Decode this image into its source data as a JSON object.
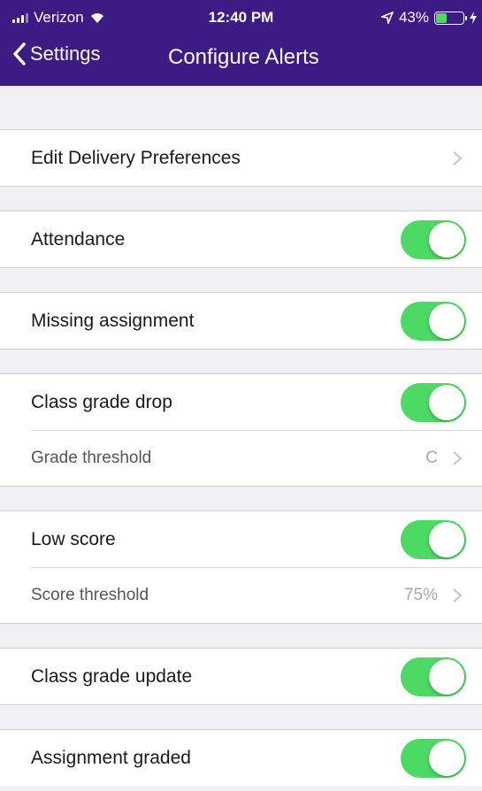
{
  "status_bar": {
    "carrier": "Verizon",
    "time": "12:40 PM",
    "battery": "43%",
    "battery_level": 0.43
  },
  "nav": {
    "back_label": "Settings",
    "title": "Configure Alerts"
  },
  "rows": {
    "delivery": "Edit Delivery Preferences",
    "attendance": "Attendance",
    "missing": "Missing assignment",
    "class_drop": "Class grade drop",
    "grade_threshold": "Grade threshold",
    "grade_threshold_value": "C",
    "low_score": "Low score",
    "score_threshold": "Score threshold",
    "score_threshold_value": "75%",
    "class_update": "Class grade update",
    "assignment_graded": "Assignment graded"
  },
  "toggles": {
    "attendance": true,
    "missing": true,
    "class_drop": true,
    "low_score": true,
    "class_update": true,
    "assignment_graded": true
  },
  "colors": {
    "nav_bg": "#3d1b84",
    "toggle_on": "#4cd964",
    "battery_fill": "#4cd964"
  }
}
